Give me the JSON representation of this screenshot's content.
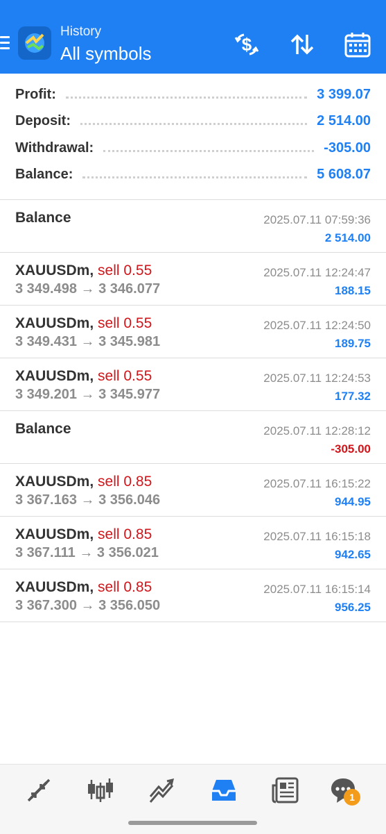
{
  "header": {
    "title": "History",
    "subtitle": "All symbols"
  },
  "summary": [
    {
      "label": "Profit:",
      "value": "3 399.07"
    },
    {
      "label": "Deposit:",
      "value": "2 514.00"
    },
    {
      "label": "Withdrawal:",
      "value": "-305.00"
    },
    {
      "label": "Balance:",
      "value": "5 608.07"
    }
  ],
  "deals": [
    {
      "kind": "balance",
      "title": "Balance",
      "time": "2025.07.11 07:59:36",
      "profit": "2 514.00",
      "negative": false
    },
    {
      "kind": "trade",
      "symbol": "XAUUSDm,",
      "type": "sell 0.55",
      "open": "3 349.498",
      "arrow": "→",
      "close": "3 346.077",
      "time": "2025.07.11 12:24:47",
      "profit": "188.15",
      "negative": false
    },
    {
      "kind": "trade",
      "symbol": "XAUUSDm,",
      "type": "sell 0.55",
      "open": "3 349.431",
      "arrow": "→",
      "close": "3 345.981",
      "time": "2025.07.11 12:24:50",
      "profit": "189.75",
      "negative": false
    },
    {
      "kind": "trade",
      "symbol": "XAUUSDm,",
      "type": "sell 0.55",
      "open": "3 349.201",
      "arrow": "→",
      "close": "3 345.977",
      "time": "2025.07.11 12:24:53",
      "profit": "177.32",
      "negative": false
    },
    {
      "kind": "balance",
      "title": "Balance",
      "time": "2025.07.11 12:28:12",
      "profit": "-305.00",
      "negative": true
    },
    {
      "kind": "trade",
      "symbol": "XAUUSDm,",
      "type": "sell 0.85",
      "open": "3 367.163",
      "arrow": "→",
      "close": "3 356.046",
      "time": "2025.07.11 16:15:22",
      "profit": "944.95",
      "negative": false
    },
    {
      "kind": "trade",
      "symbol": "XAUUSDm,",
      "type": "sell 0.85",
      "open": "3 367.111",
      "arrow": "→",
      "close": "3 356.021",
      "time": "2025.07.11 16:15:18",
      "profit": "942.65",
      "negative": false
    },
    {
      "kind": "trade",
      "symbol": "XAUUSDm,",
      "type": "sell 0.85",
      "open": "3 367.300",
      "arrow": "→",
      "close": "3 356.050",
      "time": "2025.07.11 16:15:14",
      "profit": "956.25",
      "negative": false
    }
  ],
  "bottom_nav": [
    {
      "icon": "quotes-icon"
    },
    {
      "icon": "chart-icon"
    },
    {
      "icon": "trade-icon"
    },
    {
      "icon": "history-icon",
      "active": true
    },
    {
      "icon": "news-icon"
    },
    {
      "icon": "messages-icon",
      "badge": "1"
    }
  ],
  "colors": {
    "accent": "#1f80f4",
    "negative": "#d0161b",
    "badge": "#f39c1c"
  }
}
